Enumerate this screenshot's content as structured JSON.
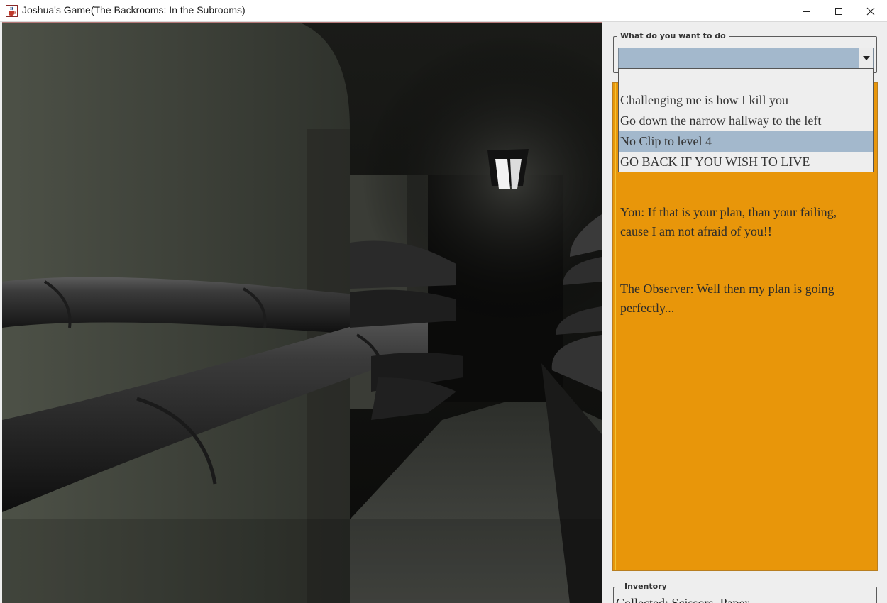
{
  "window": {
    "title": "Joshua's Game(The Backrooms: In the Subrooms)",
    "app_icon": "java-cup-icon",
    "controls": [
      "minimize-icon",
      "maximize-icon",
      "close-icon"
    ]
  },
  "scene": {
    "description_icon": "backrooms-pipe-corridor-image"
  },
  "actions": {
    "group_title": "What do you want to do",
    "selected_value": "",
    "options": [
      "",
      "Challenging me is how I kill you",
      "Go down the narrow hallway to the left",
      "No Clip to level 4",
      "GO BACK IF YOU WISH TO LIVE"
    ],
    "highlighted_option": "No Clip to level 4"
  },
  "story": {
    "lines": [
      "You: If that is your plan, than your failing,",
      "cause I am not afraid of you!!",
      "The Observer: Well then my plan is going",
      "perfectly..."
    ]
  },
  "inventory": {
    "group_title": "Inventory",
    "text": "Collected: Scissors, Paper"
  },
  "colors": {
    "story_background": "#e8960a",
    "selection": "#a3b8cc",
    "panel": "#eeeeee"
  }
}
